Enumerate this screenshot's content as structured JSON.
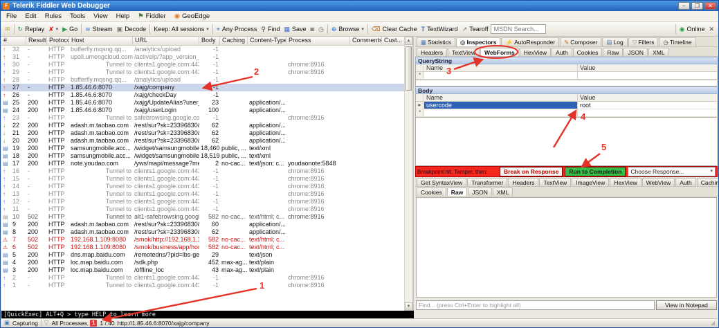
{
  "window": {
    "title": "Telerik Fiddler Web Debugger",
    "controls": {
      "minimize": "–",
      "maximize": "❐",
      "close": "✕"
    }
  },
  "menu": {
    "items": [
      {
        "label": "File"
      },
      {
        "label": "Edit"
      },
      {
        "label": "Rules"
      },
      {
        "label": "Tools"
      },
      {
        "label": "View"
      },
      {
        "label": "Help"
      },
      {
        "label": "Fiddler",
        "icon": "⚑",
        "iconColor": "#3a7d2c"
      },
      {
        "label": "GeoEdge",
        "icon": "◉",
        "iconColor": "#e07820"
      }
    ]
  },
  "toolbar": {
    "comment_icon": "✉",
    "replay": {
      "icon": "↻",
      "label": "Replay"
    },
    "remove": {
      "icon": "✘",
      "arrow": "▾"
    },
    "go": {
      "icon": "▶",
      "label": "Go"
    },
    "stream": {
      "icon": "≋",
      "label": "Stream"
    },
    "decode": {
      "icon": "▣",
      "label": "Decode"
    },
    "keep": {
      "label": "Keep: All sessions",
      "arrow": "▾"
    },
    "any_process": {
      "icon": "⌖",
      "label": "Any Process"
    },
    "find": {
      "icon": "⚲",
      "label": "Find"
    },
    "save": {
      "icon": "▦",
      "label": "Save"
    },
    "camera_icon": "◙",
    "clock_icon": "◷",
    "browse": {
      "icon": "⊕",
      "label": "Browse",
      "arrow": "▾"
    },
    "clear_cache": {
      "icon": "⌫",
      "label": "Clear Cache"
    },
    "textwizard": {
      "icon": "T",
      "label": "TextWizard"
    },
    "tearoff": {
      "icon": "↗",
      "label": "Tearoff"
    },
    "msdn_placeholder": "MSDN Search...",
    "online": {
      "icon": "◉",
      "label": "Online"
    },
    "close_icon": "✕"
  },
  "sessions": {
    "columns": [
      {
        "label": "#",
        "cls": "h0"
      },
      {
        "label": "Result",
        "cls": "h1"
      },
      {
        "label": "Protocol",
        "cls": "h2"
      },
      {
        "label": "Host",
        "cls": "h3"
      },
      {
        "label": "URL",
        "cls": "h4"
      },
      {
        "label": "Body",
        "cls": "h5"
      },
      {
        "label": "Caching",
        "cls": "h6"
      },
      {
        "label": "Content-Type",
        "cls": "h7"
      },
      {
        "label": "Process",
        "cls": "h8"
      },
      {
        "label": "Comments",
        "cls": "h9"
      },
      {
        "label": "Cust...",
        "cls": "h10"
      }
    ],
    "rows": [
      {
        "icon": "↑",
        "iconColor": "#b0622a",
        "num": "32",
        "result": "-",
        "protocol": "HTTP",
        "host": "bufferfly.mqsng.qq...",
        "url": "/analytics/upload",
        "body": "-1",
        "caching": "",
        "contentType": "",
        "process": "",
        "color": "#8a8a8a"
      },
      {
        "icon": "↑",
        "iconColor": "#b0622a",
        "num": "31",
        "result": "-",
        "protocol": "HTTP",
        "host": "upoll.umengcloud.com",
        "url": "/activelp/?app_version_co...",
        "body": "-1",
        "caching": "",
        "contentType": "",
        "process": "",
        "color": "#8a8a8a"
      },
      {
        "icon": "↑",
        "iconColor": "#3a6fd8",
        "num": "30",
        "result": "-",
        "protocol": "HTTP",
        "host": "Tunnel to",
        "url": "clients1.google.com:443",
        "body": "-1",
        "caching": "",
        "contentType": "",
        "process": "chrome:8916",
        "color": "#8a8a8a",
        "cls": "tun"
      },
      {
        "icon": "↑",
        "iconColor": "#3a6fd8",
        "num": "29",
        "result": "-",
        "protocol": "HTTP",
        "host": "Tunnel to",
        "url": "clients1.google.com:443",
        "body": "-1",
        "caching": "",
        "contentType": "",
        "process": "chrome:8916",
        "color": "#8a8a8a",
        "cls": "tun"
      },
      {
        "icon": "↑",
        "iconColor": "#b0622a",
        "num": "28",
        "result": "-",
        "protocol": "HTTP",
        "host": "bufferfly.mqsng.qq...",
        "url": "/analytics/upload",
        "body": "-1",
        "caching": "",
        "contentType": "",
        "process": "",
        "color": "#8a8a8a"
      },
      {
        "icon": "↑",
        "iconColor": "#d03030",
        "num": "27",
        "result": "-",
        "protocol": "HTTP",
        "host": "1.85.46.6:8070",
        "url": "/xajg/company",
        "body": "-1",
        "caching": "",
        "contentType": "",
        "process": "",
        "color": "#222222",
        "cls": "sel"
      },
      {
        "icon": "↑",
        "iconColor": "#d03030",
        "num": "26",
        "result": "-",
        "protocol": "HTTP",
        "host": "1.85.46.6:8070",
        "url": "/xajg/checkDay",
        "body": "-1",
        "caching": "",
        "contentType": "",
        "process": "",
        "color": "#222222"
      },
      {
        "icon": "▤",
        "iconColor": "#5b7fb5",
        "num": "25",
        "result": "200",
        "protocol": "HTTP",
        "host": "1.85.46.6:8070",
        "url": "/xajg/UpdateAlias?user_c...",
        "body": "23",
        "caching": "",
        "contentType": "application/...",
        "process": "",
        "color": "#111111"
      },
      {
        "icon": "▤",
        "iconColor": "#5b7fb5",
        "num": "24",
        "result": "200",
        "protocol": "HTTP",
        "host": "1.85.46.6:8070",
        "url": "/xajg/userLogin",
        "body": "100",
        "caching": "",
        "contentType": "application/...",
        "process": "",
        "color": "#111111"
      },
      {
        "icon": "↑",
        "iconColor": "#3a6fd8",
        "num": "23",
        "result": "-",
        "protocol": "HTTP",
        "host": "Tunnel to",
        "url": "safebrowsing.google.com...",
        "body": "-1",
        "caching": "",
        "contentType": "",
        "process": "chrome:8916",
        "color": "#8a8a8a",
        "cls": "tun"
      },
      {
        "icon": "↓",
        "iconColor": "#2e9e4f",
        "num": "22",
        "result": "200",
        "protocol": "HTTP",
        "host": "adash.m.taobao.com",
        "url": "/rest/sur?sk=23396830&...",
        "body": "62",
        "caching": "",
        "contentType": "application/...",
        "process": "",
        "color": "#111111"
      },
      {
        "icon": "↓",
        "iconColor": "#2e9e4f",
        "num": "21",
        "result": "200",
        "protocol": "HTTP",
        "host": "adash.m.taobao.com",
        "url": "/rest/sur?sk=23396830&...",
        "body": "62",
        "caching": "",
        "contentType": "application/...",
        "process": "",
        "color": "#111111"
      },
      {
        "icon": "↓",
        "iconColor": "#2e9e4f",
        "num": "20",
        "result": "200",
        "protocol": "HTTP",
        "host": "adash.m.taobao.com",
        "url": "/rest/sur?sk=23396830&...",
        "body": "62",
        "caching": "",
        "contentType": "application/...",
        "process": "",
        "color": "#111111"
      },
      {
        "icon": "▤",
        "iconColor": "#5b7fb5",
        "num": "19",
        "result": "200",
        "protocol": "HTTP",
        "host": "samsungmobile.acc...",
        "url": "/widget/samsungmobile/w...",
        "body": "18,460",
        "caching": "public, ...",
        "contentType": "text/xml",
        "process": "",
        "color": "#111111"
      },
      {
        "icon": "▤",
        "iconColor": "#5b7fb5",
        "num": "18",
        "result": "200",
        "protocol": "HTTP",
        "host": "samsungmobile.acc...",
        "url": "/widget/samsungmobile/w...",
        "body": "18,519",
        "caching": "public, ...",
        "contentType": "text/xml",
        "process": "",
        "color": "#111111"
      },
      {
        "icon": "▤",
        "iconColor": "#5b7fb5",
        "num": "17",
        "result": "200",
        "protocol": "HTTP",
        "host": "note.youdao.com",
        "url": "/yws/mapi/message?meth...",
        "body": "2",
        "caching": "no-cac...",
        "contentType": "text/json; c...",
        "process": "youdaonote:5848",
        "color": "#111111"
      },
      {
        "icon": "↑",
        "iconColor": "#3a6fd8",
        "num": "16",
        "result": "-",
        "protocol": "HTTP",
        "host": "Tunnel to",
        "url": "clients1.google.com:443",
        "body": "-1",
        "caching": "",
        "contentType": "",
        "process": "chrome:8916",
        "color": "#8a8a8a",
        "cls": "tun"
      },
      {
        "icon": "↑",
        "iconColor": "#3a6fd8",
        "num": "15",
        "result": "-",
        "protocol": "HTTP",
        "host": "Tunnel to",
        "url": "clients1.google.com:443",
        "body": "-1",
        "caching": "",
        "contentType": "",
        "process": "chrome:8916",
        "color": "#8a8a8a",
        "cls": "tun"
      },
      {
        "icon": "↑",
        "iconColor": "#3a6fd8",
        "num": "14",
        "result": "-",
        "protocol": "HTTP",
        "host": "Tunnel to",
        "url": "clients1.google.com:443",
        "body": "-1",
        "caching": "",
        "contentType": "",
        "process": "chrome:8916",
        "color": "#8a8a8a",
        "cls": "tun"
      },
      {
        "icon": "↑",
        "iconColor": "#3a6fd8",
        "num": "13",
        "result": "-",
        "protocol": "HTTP",
        "host": "Tunnel to",
        "url": "clients1.google.com:443",
        "body": "-1",
        "caching": "",
        "contentType": "",
        "process": "chrome:8916",
        "color": "#8a8a8a",
        "cls": "tun"
      },
      {
        "icon": "↑",
        "iconColor": "#3a6fd8",
        "num": "12",
        "result": "-",
        "protocol": "HTTP",
        "host": "Tunnel to",
        "url": "clients1.google.com:443",
        "body": "-1",
        "caching": "",
        "contentType": "",
        "process": "chrome:8916",
        "color": "#8a8a8a",
        "cls": "tun"
      },
      {
        "icon": "↑",
        "iconColor": "#3a6fd8",
        "num": "11",
        "result": "-",
        "protocol": "HTTP",
        "host": "Tunnel to",
        "url": "clients1.google.com:443",
        "body": "-1",
        "caching": "",
        "contentType": "",
        "process": "chrome:8916",
        "color": "#8a8a8a",
        "cls": "tun"
      },
      {
        "icon": "▤",
        "iconColor": "#9a9a9a",
        "num": "10",
        "result": "502",
        "protocol": "HTTP",
        "host": "Tunnel to",
        "url": "alt1-safebrowsing.google...",
        "body": "582",
        "caching": "no-cac...",
        "contentType": "text/html; c...",
        "process": "chrome:8916",
        "color": "#555555",
        "cls": "tun"
      },
      {
        "icon": "▤",
        "iconColor": "#5b7fb5",
        "num": "9",
        "result": "200",
        "protocol": "HTTP",
        "host": "adash.m.taobao.com",
        "url": "/rest/sur?sk=23396830&...",
        "body": "60",
        "caching": "",
        "contentType": "application/...",
        "process": "",
        "color": "#111111"
      },
      {
        "icon": "▤",
        "iconColor": "#5b7fb5",
        "num": "8",
        "result": "200",
        "protocol": "HTTP",
        "host": "adash.m.taobao.com",
        "url": "/rest/sur?sk=23396830&...",
        "body": "62",
        "caching": "",
        "contentType": "application/...",
        "process": "",
        "color": "#111111"
      },
      {
        "icon": "⚠",
        "iconColor": "#cc1111",
        "num": "7",
        "result": "502",
        "protocol": "HTTP",
        "host": "192.168.1.109:8080",
        "url": "/smok/http://192.168.1.1...",
        "body": "582",
        "caching": "no-cac...",
        "contentType": "text/html; c...",
        "process": "",
        "color": "#cc1111"
      },
      {
        "icon": "⚠",
        "iconColor": "#cc1111",
        "num": "6",
        "result": "502",
        "protocol": "HTTP",
        "host": "192.168.1.109:8080",
        "url": "/smok/business/app/home",
        "body": "582",
        "caching": "no-cac...",
        "contentType": "text/html; c...",
        "process": "",
        "color": "#cc1111"
      },
      {
        "icon": "▤",
        "iconColor": "#5b7fb5",
        "num": "5",
        "result": "200",
        "protocol": "HTTP",
        "host": "dns.map.baidu.com",
        "url": "/remotedns/?pid=lbs-geolo...",
        "body": "29",
        "caching": "",
        "contentType": "text/json",
        "process": "",
        "color": "#111111"
      },
      {
        "icon": "▤",
        "iconColor": "#5b7fb5",
        "num": "4",
        "result": "200",
        "protocol": "HTTP",
        "host": "loc.map.baidu.com",
        "url": "/sdk.php",
        "body": "452",
        "caching": "max-ag...",
        "contentType": "text/plain",
        "process": "",
        "color": "#111111"
      },
      {
        "icon": "▤",
        "iconColor": "#5b7fb5",
        "num": "3",
        "result": "200",
        "protocol": "HTTP",
        "host": "loc.map.baidu.com",
        "url": "/offline_loc",
        "body": "43",
        "caching": "max-ag...",
        "contentType": "text/plain",
        "process": "",
        "color": "#111111"
      },
      {
        "icon": "↑",
        "iconColor": "#3a6fd8",
        "num": "2",
        "result": "-",
        "protocol": "HTTP",
        "host": "Tunnel to",
        "url": "clients1.google.com:443",
        "body": "-1",
        "caching": "",
        "contentType": "",
        "process": "chrome:8916",
        "color": "#8a8a8a",
        "cls": "tun"
      },
      {
        "icon": "↑",
        "iconColor": "#3a6fd8",
        "num": "1",
        "result": "-",
        "protocol": "HTTP",
        "host": "Tunnel to",
        "url": "clients1.google.com:443",
        "body": "-1",
        "caching": "",
        "contentType": "",
        "process": "chrome:8916",
        "color": "#8a8a8a",
        "cls": "tun"
      }
    ]
  },
  "rightPanel": {
    "mainTabs": [
      {
        "label": "Statistics",
        "icon": "▦",
        "iconColor": "#4a7ab5"
      },
      {
        "label": "Inspectors",
        "icon": "◎",
        "iconColor": "#555555",
        "cls": "active"
      },
      {
        "label": "AutoResponder",
        "icon": "⚡",
        "iconColor": "#e8a000"
      },
      {
        "label": "Composer",
        "icon": "✎",
        "iconColor": "#b5651d"
      },
      {
        "label": "Log",
        "icon": "▤",
        "iconColor": "#4a7ab5"
      },
      {
        "label": "Filters",
        "icon": "▽",
        "iconColor": "#888888"
      },
      {
        "label": "Timeline",
        "icon": "◷",
        "iconColor": "#555555"
      }
    ],
    "requestTabs": [
      {
        "label": "Headers"
      },
      {
        "label": "TextView"
      },
      {
        "label": "WebForms",
        "cls": "active"
      },
      {
        "label": "HexView"
      },
      {
        "label": "Auth"
      },
      {
        "label": "Cookies"
      },
      {
        "label": "Raw"
      },
      {
        "label": "JSON"
      },
      {
        "label": "XML"
      }
    ],
    "querystring": {
      "title": "QueryString",
      "name_col": "Name",
      "value_col": "Value",
      "new_marker": "*"
    },
    "bodySection": {
      "title": "Body",
      "name_col": "Name",
      "value_col": "Value",
      "row_marker": "▸",
      "new_marker": "*",
      "rows": [
        {
          "name": "usercode",
          "value": "root"
        }
      ]
    },
    "breakpoint": {
      "label": "Breakpoint hit. Tamper, then:",
      "break_btn": "Break on Response",
      "run_btn": "Run to Completion",
      "choose": "Choose Response...",
      "arrow": "▾"
    },
    "responseTabs1": [
      {
        "label": "Get SyntaxView"
      },
      {
        "label": "Transformer"
      },
      {
        "label": "Headers"
      },
      {
        "label": "TextView"
      },
      {
        "label": "ImageView"
      },
      {
        "label": "HexView"
      },
      {
        "label": "WebView"
      },
      {
        "label": "Auth"
      },
      {
        "label": "Caching"
      }
    ],
    "responseTabs2": [
      {
        "label": "Cookies"
      },
      {
        "label": "Raw",
        "cls": "active"
      },
      {
        "label": "JSON"
      },
      {
        "label": "XML"
      }
    ],
    "find": {
      "placeholder": "Find... (press Ctrl+Enter to highlight all)",
      "notepad_btn": "View in Notepad"
    }
  },
  "quickexec": {
    "text": "[QuickExec] ALT+Q > type HELP to learn more"
  },
  "statusbar": {
    "capturing_icon": "▣",
    "capturing": "Capturing",
    "processes_icon": "▽",
    "processes": "All Processes",
    "badge": "1",
    "count": "1 / 40",
    "url": "http://1.85.46.6:8070/xajg/company",
    "grip": "◢"
  },
  "annotations": {
    "n1": "1",
    "n2": "2",
    "n3": "3",
    "n4": "4",
    "n5": "5"
  }
}
